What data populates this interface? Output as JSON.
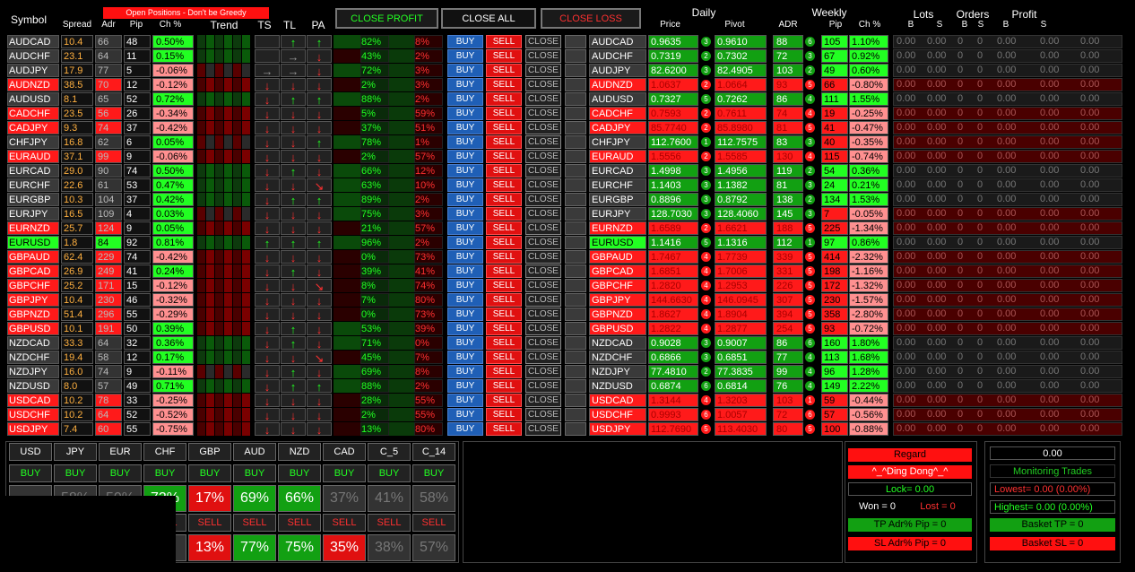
{
  "top": {
    "title_small": "",
    "warning": "Open Positions - Don't be Greedy"
  },
  "controls": {
    "close_profit": "CLOSE PROFIT",
    "close_all": "CLOSE ALL",
    "close_loss": "CLOSE LOSS"
  },
  "headers": {
    "symbol": "Symbol",
    "spread": "Spread",
    "adr": "Adr",
    "pip": "Pip",
    "ch": "Ch %",
    "trend": "Trend",
    "ts": "TS",
    "tl": "TL",
    "pa": "PA",
    "daily": "Daily",
    "price": "Price",
    "pivot": "Pivot",
    "adr2": "ADR",
    "weekly": "Weekly",
    "wpip": "Pip",
    "wch": "Ch %",
    "lots": "Lots",
    "orders": "Orders",
    "profit": "Profit",
    "b": "B",
    "s": "S"
  },
  "buttons": {
    "buy": "BUY",
    "sell": "SELL",
    "close": "CLOSE"
  },
  "rows": [
    [
      "AUDCAD",
      "10.4",
      "66",
      "48",
      "0.50%",
      "g",
      "r",
      "up",
      "up",
      "82%",
      "8%",
      "0.9635",
      "3",
      "0.9610",
      "88",
      "6",
      "105",
      "1.10%"
    ],
    [
      "AUDCHF",
      "23.1",
      "64",
      "11",
      "0.15%",
      "g",
      "r",
      "rt",
      "dn",
      "43%",
      "2%",
      "0.7319",
      "2",
      "0.7302",
      "72",
      "3",
      "67",
      "0.92%"
    ],
    [
      "AUDJPY",
      "17.9",
      "77",
      "5",
      "-0.06%",
      "d",
      "rt",
      "rt",
      "dn",
      "72%",
      "3%",
      "82.6200",
      "3",
      "82.4905",
      "103",
      "2",
      "49",
      "0.60%"
    ],
    [
      "AUDNZD",
      "38.5",
      "70",
      "12",
      "-0.12%",
      "r",
      "dn",
      "dn",
      "dn",
      "2%",
      "3%",
      "1.0637",
      "2",
      "1.0664",
      "93",
      "5",
      "66",
      "-0.80%"
    ],
    [
      "AUDUSD",
      "8.1",
      "65",
      "52",
      "0.72%",
      "g",
      "dn",
      "up",
      "up",
      "88%",
      "2%",
      "0.7327",
      "5",
      "0.7262",
      "86",
      "4",
      "111",
      "1.55%"
    ],
    [
      "CADCHF",
      "23.5",
      "56",
      "26",
      "-0.34%",
      "r",
      "dn",
      "dn",
      "dn",
      "5%",
      "59%",
      "0.7593",
      "2",
      "0.7611",
      "74",
      "4",
      "19",
      "-0.25%"
    ],
    [
      "CADJPY",
      "9.3",
      "74",
      "37",
      "-0.42%",
      "r",
      "dn",
      "dn",
      "dn",
      "37%",
      "51%",
      "85.7740",
      "2",
      "85.8980",
      "81",
      "5",
      "41",
      "-0.47%"
    ],
    [
      "CHFJPY",
      "16.8",
      "62",
      "6",
      "0.05%",
      "d",
      "dn",
      "dn",
      "up",
      "78%",
      "1%",
      "112.7600",
      "1",
      "112.7575",
      "83",
      "3",
      "40",
      "-0.35%"
    ],
    [
      "EURAUD",
      "37.1",
      "99",
      "9",
      "-0.06%",
      "r",
      "dn",
      "dn",
      "dn",
      "2%",
      "57%",
      "1.5556",
      "2",
      "1.5585",
      "130",
      "4",
      "115",
      "-0.74%"
    ],
    [
      "EURCAD",
      "29.0",
      "90",
      "74",
      "0.50%",
      "g",
      "dn",
      "up",
      "dn",
      "66%",
      "12%",
      "1.4998",
      "3",
      "1.4956",
      "119",
      "2",
      "54",
      "0.36%"
    ],
    [
      "EURCHF",
      "22.6",
      "61",
      "53",
      "0.47%",
      "g",
      "dn",
      "dn",
      "dr",
      "63%",
      "10%",
      "1.1403",
      "3",
      "1.1382",
      "81",
      "3",
      "24",
      "0.21%"
    ],
    [
      "EURGBP",
      "10.3",
      "104",
      "37",
      "0.42%",
      "g",
      "dn",
      "up",
      "up",
      "89%",
      "2%",
      "0.8896",
      "3",
      "0.8792",
      "138",
      "2",
      "134",
      "1.53%"
    ],
    [
      "EURJPY",
      "16.5",
      "109",
      "4",
      "0.03%",
      "d",
      "dn",
      "dn",
      "dn",
      "75%",
      "3%",
      "128.7030",
      "3",
      "128.4060",
      "145",
      "3",
      "7",
      "-0.05%"
    ],
    [
      "EURNZD",
      "25.7",
      "124",
      "9",
      "0.05%",
      "r",
      "dn",
      "dn",
      "dn",
      "21%",
      "57%",
      "1.6589",
      "2",
      "1.6621",
      "188",
      "5",
      "225",
      "-1.34%"
    ],
    [
      "EURUSD",
      "1.8",
      "84",
      "92",
      "0.81%",
      "g",
      "up",
      "up",
      "up",
      "96%",
      "2%",
      "1.1416",
      "5",
      "1.1316",
      "112",
      "1",
      "97",
      "0.86%"
    ],
    [
      "GBPAUD",
      "62.4",
      "229",
      "74",
      "-0.42%",
      "r",
      "dn",
      "dn",
      "dn",
      "0%",
      "73%",
      "1.7467",
      "4",
      "1.7739",
      "339",
      "5",
      "414",
      "-2.32%"
    ],
    [
      "GBPCAD",
      "26.9",
      "249",
      "41",
      "0.24%",
      "r",
      "dn",
      "up",
      "dn",
      "39%",
      "41%",
      "1.6851",
      "4",
      "1.7006",
      "331",
      "5",
      "198",
      "-1.16%"
    ],
    [
      "GBPCHF",
      "25.2",
      "171",
      "15",
      "-0.12%",
      "r",
      "dn",
      "dn",
      "dr",
      "8%",
      "74%",
      "1.2820",
      "4",
      "1.2953",
      "226",
      "5",
      "172",
      "-1.32%"
    ],
    [
      "GBPJPY",
      "10.4",
      "230",
      "46",
      "-0.32%",
      "r",
      "dn",
      "dn",
      "dn",
      "7%",
      "80%",
      "144.6630",
      "4",
      "146.0945",
      "307",
      "5",
      "230",
      "-1.57%"
    ],
    [
      "GBPNZD",
      "51.4",
      "296",
      "55",
      "-0.29%",
      "r",
      "dn",
      "dn",
      "dn",
      "0%",
      "73%",
      "1.8627",
      "4",
      "1.8904",
      "394",
      "5",
      "358",
      "-2.80%"
    ],
    [
      "GBPUSD",
      "10.1",
      "191",
      "50",
      "0.39%",
      "r",
      "dn",
      "up",
      "dn",
      "53%",
      "39%",
      "1.2822",
      "4",
      "1.2877",
      "254",
      "5",
      "93",
      "-0.72%"
    ],
    [
      "NZDCAD",
      "33.3",
      "64",
      "32",
      "0.36%",
      "g",
      "dn",
      "up",
      "dn",
      "71%",
      "0%",
      "0.9028",
      "3",
      "0.9007",
      "86",
      "6",
      "160",
      "1.80%"
    ],
    [
      "NZDCHF",
      "19.4",
      "58",
      "12",
      "0.17%",
      "g",
      "dn",
      "dn",
      "dr",
      "45%",
      "7%",
      "0.6866",
      "3",
      "0.6851",
      "77",
      "4",
      "113",
      "1.68%"
    ],
    [
      "NZDJPY",
      "16.0",
      "74",
      "9",
      "-0.11%",
      "d",
      "dn",
      "up",
      "dn",
      "69%",
      "8%",
      "77.4810",
      "2",
      "77.3835",
      "99",
      "4",
      "96",
      "1.28%"
    ],
    [
      "NZDUSD",
      "8.0",
      "57",
      "49",
      "0.71%",
      "g",
      "dn",
      "up",
      "up",
      "88%",
      "2%",
      "0.6874",
      "6",
      "0.6814",
      "76",
      "4",
      "149",
      "2.22%"
    ],
    [
      "USDCAD",
      "10.2",
      "78",
      "33",
      "-0.25%",
      "r",
      "dn",
      "dn",
      "dn",
      "28%",
      "55%",
      "1.3144",
      "4",
      "1.3203",
      "103",
      "1",
      "59",
      "-0.44%"
    ],
    [
      "USDCHF",
      "10.2",
      "64",
      "52",
      "-0.52%",
      "r",
      "dn",
      "dn",
      "dn",
      "2%",
      "55%",
      "0.9993",
      "6",
      "1.0057",
      "72",
      "6",
      "57",
      "-0.56%"
    ],
    [
      "USDJPY",
      "7.4",
      "60",
      "55",
      "-0.75%",
      "r",
      "dn",
      "dn",
      "dn",
      "13%",
      "80%",
      "112.7690",
      "5",
      "113.4030",
      "80",
      "5",
      "100",
      "-0.88%"
    ]
  ],
  "zeros": "0.00",
  "zero_int": "0",
  "currencies": [
    "USD",
    "JPY",
    "EUR",
    "CHF",
    "GBP",
    "AUD",
    "NZD",
    "CAD",
    "C_5",
    "C_14"
  ],
  "buy_pcts": [
    "",
    "58%",
    "50%",
    "73%",
    "17%",
    "69%",
    "66%",
    "37%",
    "41%",
    "58%"
  ],
  "sell_pcts": [
    "",
    "",
    "",
    "",
    "13%",
    "77%",
    "75%",
    "35%",
    "38%",
    "57%"
  ],
  "right_panel": {
    "regard": "Regard",
    "ding": "^_^Ding Dong^_^",
    "lock": "Lock= 0.00",
    "won": "Won =  0",
    "lost": "Lost =  0",
    "tp": "TP Adr% Pip = 0",
    "sl": "SL Adr% Pip = 0",
    "total": "0.00",
    "monitoring": "Monitoring Trades",
    "lowest": "Lowest= 0.00 (0.00%)",
    "highest": "Highest= 0.00 (0.00%)",
    "basket_tp": "Basket TP = 0",
    "basket_sl": "Basket SL = 0"
  },
  "colors": {
    "red": "#ff1a1a",
    "green": "#12a012",
    "bright_green": "#22ff22",
    "dark_red": "#5a0000",
    "dark_green": "#0a4a0a"
  }
}
